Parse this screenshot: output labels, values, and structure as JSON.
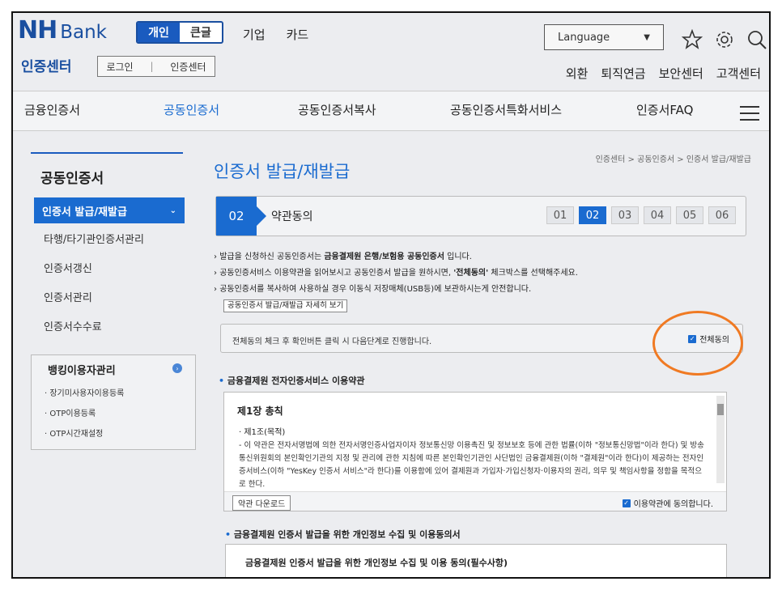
{
  "header": {
    "logo_nh": "NH",
    "logo_bank": "Bank",
    "seg_personal": "개인",
    "seg_small": "큰글",
    "topnav": [
      "기업",
      "카드"
    ],
    "language": "Language",
    "sub_title": "인증센터",
    "sub_login": "로그인",
    "sub_center": "인증센터",
    "rightnav": [
      "외환",
      "퇴직연금",
      "보안센터",
      "고객센터"
    ]
  },
  "navbar": {
    "items": [
      "금융인증서",
      "공동인증서",
      "공동인증서복사",
      "공동인증서특화서비스",
      "인증서FAQ"
    ]
  },
  "sidebar": {
    "title": "공동인증서",
    "active": "인증서 발급/재발급",
    "items": [
      "타행/타기관인증서관리",
      "인증서갱신",
      "인증서관리",
      "인증서수수료"
    ],
    "box_title": "뱅킹이용자관리",
    "box_items": [
      "장기미사용자이용등록",
      "OTP이용등록",
      "OTP시간재설정"
    ]
  },
  "breadcrumb": "인증센터 > 공동인증서 > 인증서 발급/재발급",
  "page_title": "인증서 발급/재발급",
  "stepbar": {
    "current_num": "02",
    "current_label": "약관동의",
    "steps": [
      "01",
      "02",
      "03",
      "04",
      "05",
      "06"
    ]
  },
  "notes": {
    "n1_pre": "발급을 신청하신 공동인증서는 ",
    "n1_bold": "금융결제원 은행/보험용 공동인증서",
    "n1_post": " 입니다.",
    "n2_pre": "공동인증서비스 이용약관을 읽어보시고 공동인증서 발급을 원하시면, ",
    "n2_bold": "'전체동의'",
    "n2_post": " 체크박스를 선택해주세요.",
    "n3": "공동인증서를 복사하여 사용하실 경우 이동식 저장매체(USB등)에 보관하시는게 안전합니다.",
    "view_button": "공동인증서 발급/재발급 자세히 보기"
  },
  "agree_all": {
    "text": "전체동의 체크 후 확인버튼 클릭 시 다음단계로 진행합니다.",
    "label": "전체동의"
  },
  "section1": {
    "title": "금융결제원 전자인증서비스 이용약관",
    "chapter": "제1장 총칙",
    "article": "제1조(목적)",
    "body": "- 이 약관은 전자서명법에 의한 전자서명인증사업자이자 정보통신망 이용촉진 및 정보보호 등에 관한 법률(이하 \"정보통신망법\"이라 한다) 및 방송통신위원회의 본인확인기관의 지정 및 관리에 관한 지침에 따른 본인확인기관인 사단법인 금융결제원(이하 \"결제원\"이라 한다)이 제공하는 전자인증서비스(이하 \"YesKey 인증서 서비스\"라 한다)를 이용함에 있어 결제원과 가입자·가입신청자·이용자의 권리, 의무 및 책임사항을 정함을 목적으로 한다.",
    "download": "약관 다운로드",
    "agree": "이용약관에 동의합니다."
  },
  "section2": {
    "title": "금융결제원 인증서 발급을 위한 개인정보 수집 및 이용동의서",
    "box_title": "금융결제원 인증서 발급을 위한 개인정보 수집 및 이용 동의(필수사항)"
  },
  "colors": {
    "brand": "#1a4fa0",
    "accent": "#1a6bd0",
    "highlight": "#f07a23"
  }
}
